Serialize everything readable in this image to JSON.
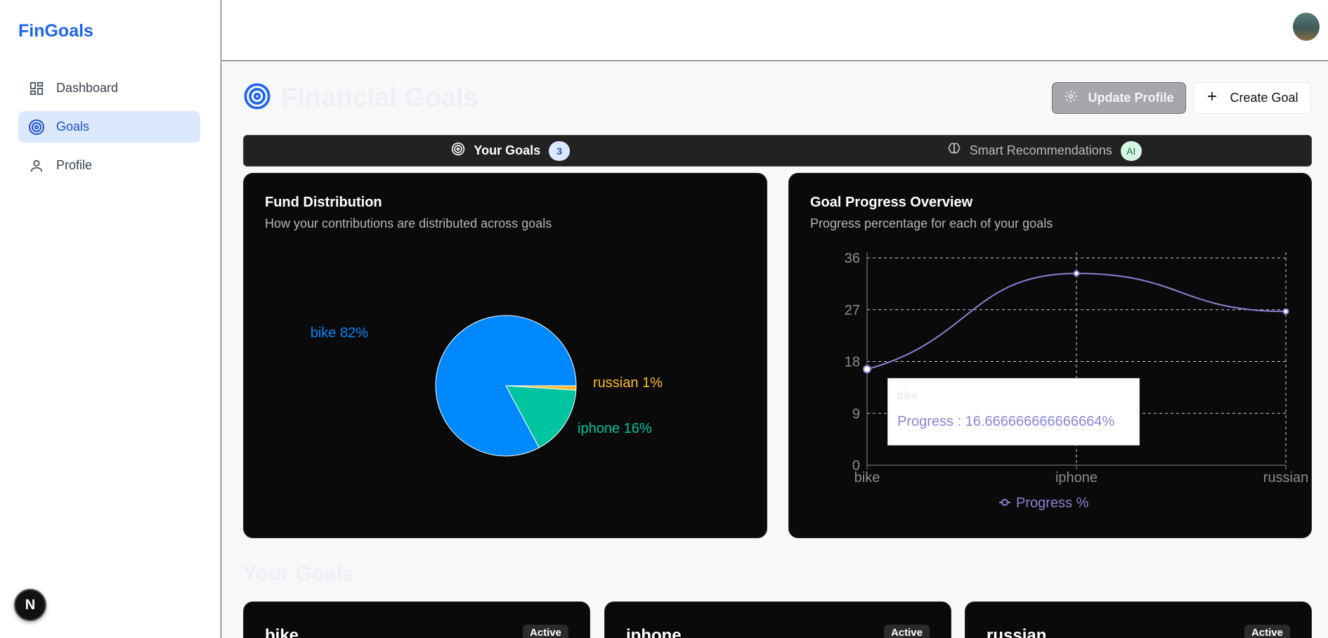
{
  "app": {
    "brand": "FinGoals"
  },
  "sidebar": {
    "items": [
      {
        "label": "Dashboard",
        "icon": "dashboard-icon"
      },
      {
        "label": "Goals",
        "icon": "target-icon"
      },
      {
        "label": "Profile",
        "icon": "user-icon"
      }
    ],
    "active_index": 1,
    "footer_badge": "N"
  },
  "header": {
    "title": "Financial Goals",
    "update_profile_label": "Update Profile",
    "create_goal_label": "Create Goal"
  },
  "tabs": [
    {
      "label": "Your Goals",
      "badge": "3",
      "icon": "target-icon"
    },
    {
      "label": "Smart Recommendations",
      "badge": "AI",
      "icon": "brain-icon"
    }
  ],
  "fund_distribution": {
    "title": "Fund Distribution",
    "subtitle": "How your contributions are distributed across goals"
  },
  "goal_progress": {
    "title": "Goal Progress Overview",
    "subtitle": "Progress percentage for each of your goals",
    "tooltip": {
      "label": "bike",
      "value": "Progress : 16.666666666666664%"
    }
  },
  "chart_data": [
    {
      "type": "pie",
      "slices": [
        {
          "name": "bike",
          "value": 82,
          "label": "bike 82%",
          "color": "#0088fe"
        },
        {
          "name": "iphone",
          "value": 16,
          "label": "iphone 16%",
          "color": "#00c49f"
        },
        {
          "name": "russian",
          "value": 1,
          "label": "russian 1%",
          "color": "#ffbb28"
        }
      ]
    },
    {
      "type": "line",
      "categories": [
        "bike",
        "iphone",
        "russian"
      ],
      "series": [
        {
          "name": "Progress %",
          "values": [
            16.666666666666664,
            33.3,
            26.7
          ],
          "color": "#8884d8"
        }
      ],
      "y_ticks": [
        "0",
        "9",
        "18",
        "27",
        "36"
      ],
      "ylim": [
        0,
        36
      ],
      "grid": true,
      "legend": "bottom"
    }
  ],
  "goals_section": {
    "title": "Your Goals",
    "goals": [
      {
        "name": "bike",
        "status": "Active"
      },
      {
        "name": "iphone",
        "status": "Active"
      },
      {
        "name": "russian",
        "status": "Active"
      }
    ]
  }
}
